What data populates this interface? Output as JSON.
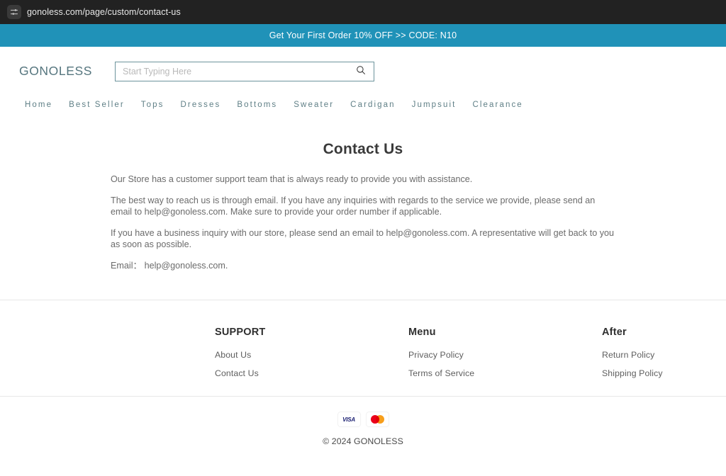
{
  "browser": {
    "icon": "sliders-icon",
    "url": "gonoless.com/page/custom/contact-us"
  },
  "promo": {
    "text": "Get Your First Order 10% OFF >> CODE: N10",
    "background": "#2092b8",
    "color": "#ffffff"
  },
  "header": {
    "logo": "GONOLESS",
    "logo_color": "#55757e",
    "search": {
      "placeholder": "Start Typing Here",
      "value": "",
      "icon": "search-icon"
    }
  },
  "nav": {
    "items": [
      {
        "label": "Home"
      },
      {
        "label": "Best Seller"
      },
      {
        "label": "Tops"
      },
      {
        "label": "Dresses"
      },
      {
        "label": "Bottoms"
      },
      {
        "label": "Sweater"
      },
      {
        "label": "Cardigan"
      },
      {
        "label": "Jumpsuit"
      },
      {
        "label": "Clearance"
      }
    ],
    "color": "#5f7f86"
  },
  "main": {
    "title": "Contact Us",
    "paragraphs": [
      "Our Store has a customer support team that is always ready to provide you with assistance.",
      "The best way to reach us is through email. If you have any inquiries with regards to the service we provide, please send an email to help@gonoless.com. Make sure to provide your order number if applicable.",
      "If you have a business inquiry with our store, please send an email to help@gonoless.com. A representative will get back to you as soon as possible."
    ],
    "email_line": "Email：  help@gonoless.com."
  },
  "footer": {
    "columns": [
      {
        "heading": "SUPPORT",
        "links": [
          {
            "label": "About Us"
          },
          {
            "label": "Contact Us"
          }
        ]
      },
      {
        "heading": "Menu",
        "links": [
          {
            "label": "Privacy Policy"
          },
          {
            "label": "Terms of Service"
          }
        ]
      },
      {
        "heading": "After",
        "links": [
          {
            "label": "Return Policy"
          },
          {
            "label": "Shipping Policy"
          }
        ]
      }
    ],
    "payments": [
      {
        "name": "visa-badge",
        "label": "VISA"
      },
      {
        "name": "mastercard-badge",
        "label": ""
      }
    ],
    "copyright": "© 2024 GONOLESS"
  }
}
